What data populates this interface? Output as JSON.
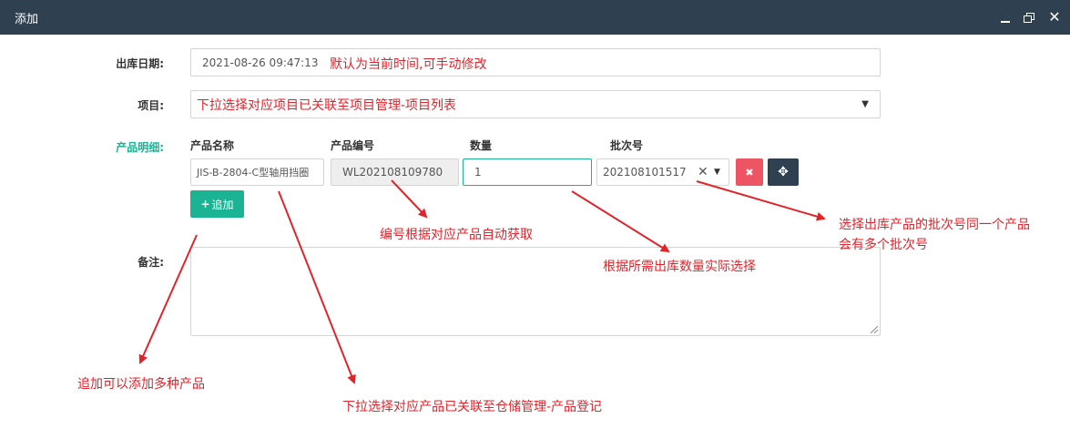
{
  "window": {
    "title": "添加"
  },
  "form": {
    "date_label": "出库日期:",
    "date_value": "2021-08-26 09:47:13",
    "project_label": "项目:",
    "detail_label": "产品明细:",
    "remark_label": "备注:"
  },
  "detail": {
    "columns": [
      "产品名称",
      "产品编号",
      "数量",
      "批次号"
    ],
    "row": {
      "name": "JIS-B-2804-C型轴用挡圈",
      "code": "WL202108109780",
      "qty": "1",
      "batch": "202108101517"
    },
    "add_label": "追加"
  },
  "annotations": {
    "date": "默认为当前时间,可手动修改",
    "project": "下拉选择对应项目已关联至项目管理-项目列表",
    "code": "编号根据对应产品自动获取",
    "qty": "根据所需出库数量实际选择",
    "batch_line1": "选择出库产品的批次号同一个产品",
    "batch_line2": "会有多个批次号",
    "add": "追加可以添加多种产品",
    "name": "下拉选择对应产品已关联至仓储管理-产品登记"
  },
  "colors": {
    "titlebar": "#2f4050",
    "primary": "#1ab394",
    "danger": "#ed5565",
    "annotation": "#e0242b"
  }
}
